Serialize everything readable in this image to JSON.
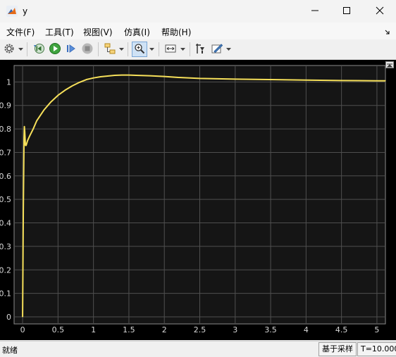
{
  "window": {
    "title": "y",
    "icons": [
      "matlab-icon",
      "minimize-icon",
      "maximize-icon",
      "close-icon"
    ]
  },
  "menu": {
    "items": [
      "文件(F)",
      "工具(T)",
      "视图(V)",
      "仿真(I)",
      "帮助(H)"
    ]
  },
  "toolbar": {
    "icons": [
      "settings-icon",
      "restore-step-back-icon",
      "run-icon",
      "step-forward-icon",
      "stop-icon",
      "signal-selector-icon",
      "zoom-icon",
      "fit-to-view-icon",
      "cursor-measure-icon",
      "style-icon"
    ]
  },
  "status": {
    "text": "就绪",
    "mode": "基于采样",
    "time": "T=10.000"
  },
  "colors": {
    "plot_background": "#151515",
    "line": "#F6E05A",
    "grid": "#4f4f4f",
    "tick_text": "#d8d8d8"
  },
  "chart_data": {
    "type": "line",
    "title": "",
    "xlabel": "",
    "ylabel": "",
    "xlim": [
      -0.12,
      5.12
    ],
    "ylim": [
      -0.03,
      1.07
    ],
    "grid": true,
    "legend": "none",
    "x_ticks": [
      "0",
      "0.5",
      "1",
      "1.5",
      "2",
      "2.5",
      "3",
      "3.5",
      "4",
      "4.5",
      "5"
    ],
    "y_ticks": [
      "0",
      "0.1",
      "0.2",
      "0.3",
      "0.4",
      "0.5",
      "0.6",
      "0.7",
      "0.8",
      "0.9",
      "1"
    ],
    "series": [
      {
        "x": [
          0,
          0.01,
          0.02,
          0.025,
          0.03,
          0.04,
          0.05,
          0.07,
          0.1,
          0.15,
          0.2,
          0.3,
          0.4,
          0.5,
          0.6,
          0.7,
          0.8,
          0.9,
          1.0,
          1.1,
          1.2,
          1.3,
          1.4,
          1.5,
          1.6,
          1.8,
          2.0,
          2.2,
          2.5,
          3.0,
          3.5,
          4.0,
          4.5,
          5.0,
          5.12
        ],
        "values": [
          0,
          0.45,
          0.76,
          0.81,
          0.79,
          0.73,
          0.73,
          0.75,
          0.77,
          0.8,
          0.835,
          0.88,
          0.915,
          0.943,
          0.965,
          0.983,
          0.998,
          1.01,
          1.017,
          1.022,
          1.025,
          1.028,
          1.029,
          1.029,
          1.028,
          1.026,
          1.023,
          1.019,
          1.015,
          1.012,
          1.01,
          1.008,
          1.006,
          1.005,
          1.005
        ]
      }
    ]
  }
}
